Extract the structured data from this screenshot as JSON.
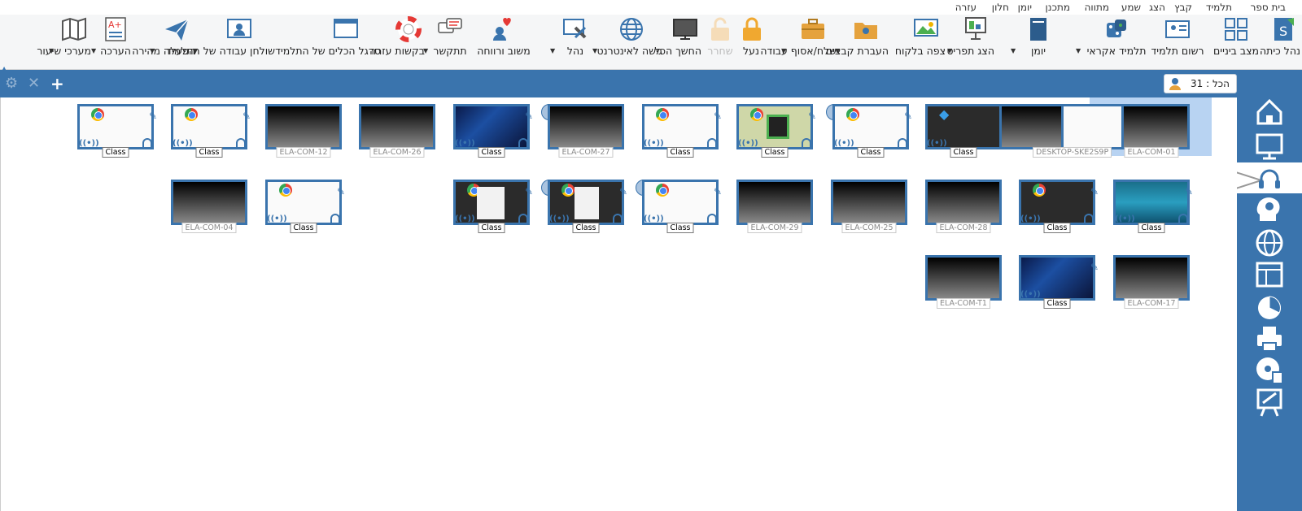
{
  "menubar": {
    "items": [
      "בית ספר",
      "תלמיד",
      "קבץ",
      "הצג",
      "שמע",
      "מתווה",
      "מתכנן",
      "יומן",
      "חלון",
      "עזרה"
    ]
  },
  "toolbar": {
    "buttons": [
      {
        "label": "נהל כיתה",
        "icon": "manage-class-icon"
      },
      {
        "label": "מצב ביניים",
        "icon": "grid-view-icon"
      },
      {
        "label": "רשום תלמיד",
        "icon": "register-student-icon"
      },
      {
        "label": "תלמיד אקראי",
        "icon": "dice-icon"
      },
      {
        "label": "יומן",
        "icon": "journal-icon"
      },
      {
        "label": "הצג תפריט",
        "icon": "show-menu-icon"
      },
      {
        "label": "צפה בלקוח",
        "icon": "view-client-icon"
      },
      {
        "label": "העברת קבצים",
        "icon": "file-transfer-icon"
      },
      {
        "label": "שלח/אסוף עבודה",
        "icon": "briefcase-icon"
      },
      {
        "label": "נעל",
        "icon": "lock-icon"
      },
      {
        "label": "שחרר",
        "icon": "unlock-icon"
      },
      {
        "label": "החשך הכל",
        "icon": "blank-screen-icon"
      },
      {
        "label": "גישה לאינטרנט",
        "icon": "globe-icon"
      },
      {
        "label": "נהל",
        "icon": "tools-icon"
      },
      {
        "label": "משוב ורווחה",
        "icon": "feedback-icon"
      },
      {
        "label": "תתקשר",
        "icon": "chat-icon"
      },
      {
        "label": "בקשות עזרה",
        "icon": "lifebuoy-icon"
      },
      {
        "label": "סרגל הכלים של התלמיד",
        "icon": "student-toolbar-icon"
      },
      {
        "label": "שולחן עבודה של התלמיד",
        "icon": "student-desktop-icon"
      },
      {
        "label": "הפעלה מהירה",
        "icon": "paper-plane-icon"
      },
      {
        "label": "הערכה",
        "icon": "assessment-icon"
      },
      {
        "label": "מערכי שיעור",
        "icon": "map-icon"
      }
    ]
  },
  "bluebar": {
    "count_label": "הכל : 31"
  },
  "thumbnails": {
    "class_tag": "Class",
    "row1": [
      {
        "name": "ELA-COM-01",
        "selected": true
      },
      {
        "name": "DESKTOP-SKE2S9P"
      },
      {
        "name": ""
      },
      {
        "name": ""
      },
      {
        "name": ""
      },
      {
        "name": ""
      },
      {
        "name": "ELA-COM-27"
      },
      {
        "name": ""
      },
      {
        "name": "ELA-COM-26"
      },
      {
        "name": "ELA-COM-12"
      },
      {
        "name": ""
      },
      {
        "name": ""
      }
    ],
    "row2": [
      {
        "name": ""
      },
      {
        "name": ""
      },
      {
        "name": "ELA-COM-28"
      },
      {
        "name": "ELA-COM-25"
      },
      {
        "name": "ELA-COM-29"
      },
      {
        "name": ""
      },
      {
        "name": ""
      },
      {
        "name": ""
      },
      {
        "name": ""
      },
      {
        "name": "ELA-COM-04"
      }
    ],
    "row3": [
      {
        "name": "ELA-COM-17"
      },
      {
        "name": ""
      },
      {
        "name": "ELA-COM-T1"
      }
    ]
  },
  "colors": {
    "accent": "#3a74ad",
    "selected_bg": "#b8d3f2"
  }
}
